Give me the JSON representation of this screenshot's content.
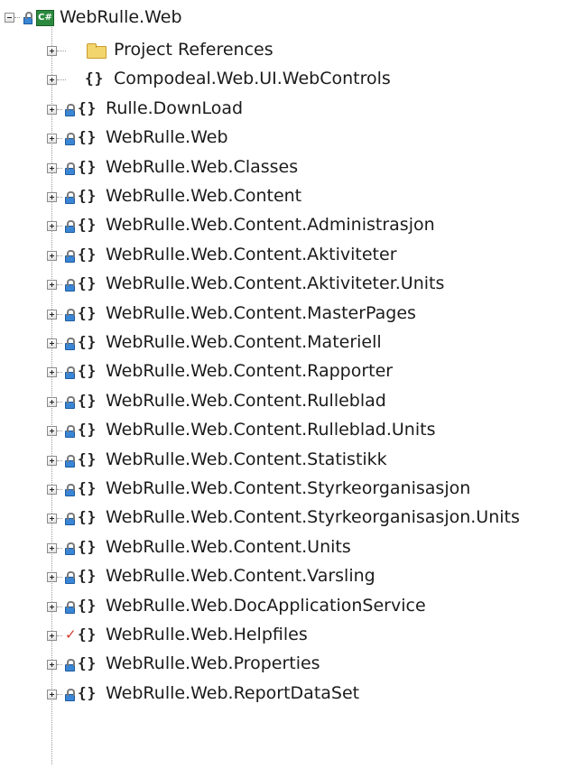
{
  "project": {
    "name": "WebRulle.Web",
    "icon": "csharp-project-icon",
    "badge": "C#"
  },
  "items": [
    {
      "label": "Project References",
      "icon": "folder-icon",
      "status": "none"
    },
    {
      "label": "Compodeal.Web.UI.WebControls",
      "icon": "namespace-icon",
      "status": "none"
    },
    {
      "label": "Rulle.DownLoad",
      "icon": "namespace-icon",
      "status": "locked"
    },
    {
      "label": "WebRulle.Web",
      "icon": "namespace-icon",
      "status": "locked"
    },
    {
      "label": "WebRulle.Web.Classes",
      "icon": "namespace-icon",
      "status": "locked"
    },
    {
      "label": "WebRulle.Web.Content",
      "icon": "namespace-icon",
      "status": "locked"
    },
    {
      "label": "WebRulle.Web.Content.Administrasjon",
      "icon": "namespace-icon",
      "status": "locked"
    },
    {
      "label": "WebRulle.Web.Content.Aktiviteter",
      "icon": "namespace-icon",
      "status": "locked"
    },
    {
      "label": "WebRulle.Web.Content.Aktiviteter.Units",
      "icon": "namespace-icon",
      "status": "locked"
    },
    {
      "label": "WebRulle.Web.Content.MasterPages",
      "icon": "namespace-icon",
      "status": "locked"
    },
    {
      "label": "WebRulle.Web.Content.Materiell",
      "icon": "namespace-icon",
      "status": "locked"
    },
    {
      "label": "WebRulle.Web.Content.Rapporter",
      "icon": "namespace-icon",
      "status": "locked"
    },
    {
      "label": "WebRulle.Web.Content.Rulleblad",
      "icon": "namespace-icon",
      "status": "locked"
    },
    {
      "label": "WebRulle.Web.Content.Rulleblad.Units",
      "icon": "namespace-icon",
      "status": "locked"
    },
    {
      "label": "WebRulle.Web.Content.Statistikk",
      "icon": "namespace-icon",
      "status": "locked"
    },
    {
      "label": "WebRulle.Web.Content.Styrkeorganisasjon",
      "icon": "namespace-icon",
      "status": "locked"
    },
    {
      "label": "WebRulle.Web.Content.Styrkeorganisasjon.Units",
      "icon": "namespace-icon",
      "status": "locked"
    },
    {
      "label": "WebRulle.Web.Content.Units",
      "icon": "namespace-icon",
      "status": "locked"
    },
    {
      "label": "WebRulle.Web.Content.Varsling",
      "icon": "namespace-icon",
      "status": "locked"
    },
    {
      "label": "WebRulle.Web.DocApplicationService",
      "icon": "namespace-icon",
      "status": "locked"
    },
    {
      "label": "WebRulle.Web.Helpfiles",
      "icon": "namespace-icon",
      "status": "checked-out"
    },
    {
      "label": "WebRulle.Web.Properties",
      "icon": "namespace-icon",
      "status": "locked"
    },
    {
      "label": "WebRulle.Web.ReportDataSet",
      "icon": "namespace-icon",
      "status": "locked"
    }
  ],
  "glyphs": {
    "braces": "{}",
    "checkmark": "✓"
  },
  "colors": {
    "lock": "#3a86d4",
    "checkmark": "#d9352b",
    "folder": "#f3d56e",
    "project": "#2b8a3e"
  }
}
